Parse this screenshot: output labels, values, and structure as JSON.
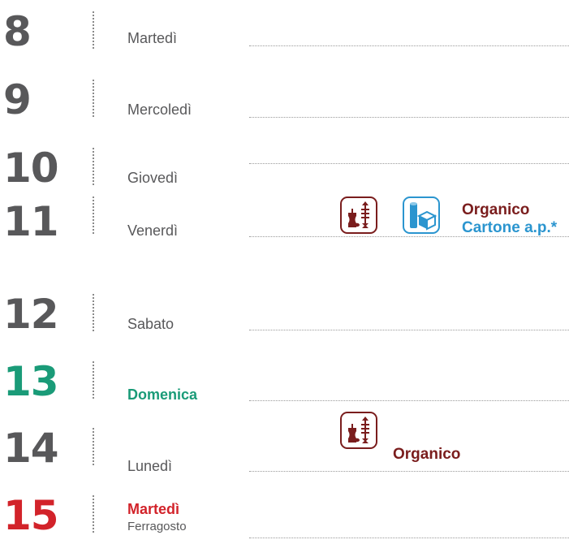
{
  "days": [
    {
      "number": "8",
      "name": "Martedì"
    },
    {
      "number": "9",
      "name": "Mercoledì"
    },
    {
      "number": "10",
      "name": "Giovedì"
    },
    {
      "number": "11",
      "name": "Venerdì"
    },
    {
      "number": "12",
      "name": "Sabato"
    },
    {
      "number": "13",
      "name": "Domenica"
    },
    {
      "number": "14",
      "name": "Lunedì"
    },
    {
      "number": "15",
      "name": "Martedì",
      "note": "Ferragosto"
    }
  ],
  "collections": {
    "day11": {
      "organic_label": "Organico",
      "cardboard_label": "Cartone a.p.*"
    },
    "day14": {
      "organic_label": "Organico"
    }
  },
  "icons": {
    "organic": "organic-waste-icon",
    "cardboard": "cardboard-icon"
  },
  "colors": {
    "default_text": "#58585a",
    "sunday": "#1a9b78",
    "holiday": "#d2232a",
    "organic": "#7a1d1d",
    "cardboard": "#2b95cf"
  }
}
